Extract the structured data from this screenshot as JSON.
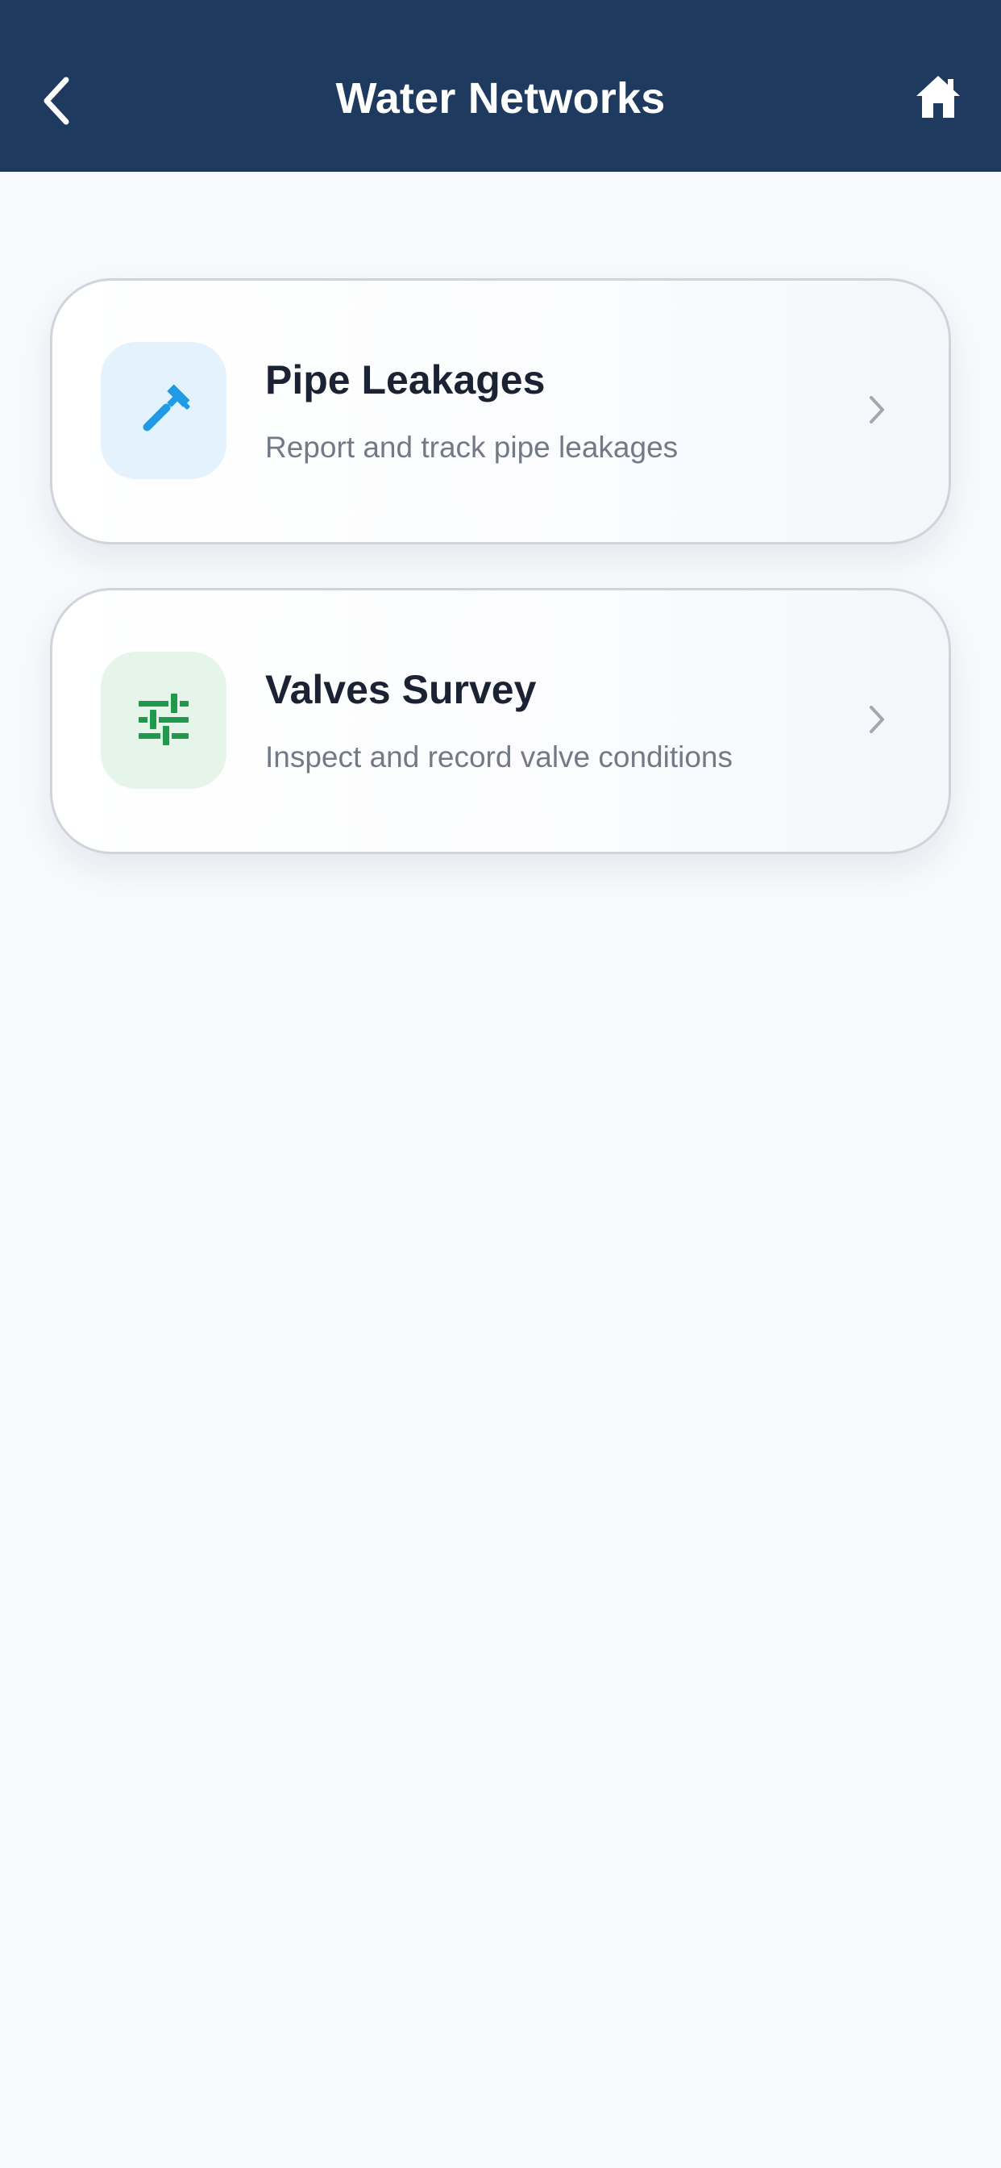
{
  "header": {
    "title": "Water Networks",
    "background_color": "#1f3a5f",
    "back_icon": "chevron-left-icon",
    "home_icon": "home-icon"
  },
  "menu": {
    "items": [
      {
        "title": "Pipe Leakages",
        "subtitle": "Report and track pipe leakages",
        "icon": "wrench-icon",
        "icon_color": "#1f9be5",
        "tile_color": "#e3f2fc"
      },
      {
        "title": "Valves Survey",
        "subtitle": "Inspect and record valve conditions",
        "icon": "sliders-icon",
        "icon_color": "#1f9a4d",
        "tile_color": "#e6f5ea"
      }
    ]
  }
}
